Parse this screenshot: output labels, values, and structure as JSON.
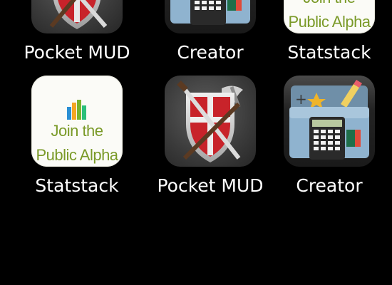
{
  "home_screen": {
    "apps": [
      {
        "id": "pocket-mud-top",
        "label": "Pocket MUD"
      },
      {
        "id": "creator-top",
        "label": "Creator"
      },
      {
        "id": "statstack-top",
        "label": "Statstack",
        "icon_text": [
          "Join the",
          "Public Alpha"
        ]
      },
      {
        "id": "statstack",
        "label": "Statstack",
        "icon_text": [
          "Join the",
          "Public Alpha"
        ]
      },
      {
        "id": "pocket-mud",
        "label": "Pocket MUD"
      },
      {
        "id": "creator",
        "label": "Creator"
      }
    ]
  },
  "icons": {
    "pocket_mud": "shield-swords-icon",
    "creator": "folder-calculator-icon",
    "statstack": "bar-chart-icon"
  },
  "colors": {
    "background": "#000000",
    "label_text": "#ffffff",
    "statstack_text": "#7a9a28",
    "shield_red": "#c8232a",
    "folder_blue": "#8fb3cf"
  }
}
